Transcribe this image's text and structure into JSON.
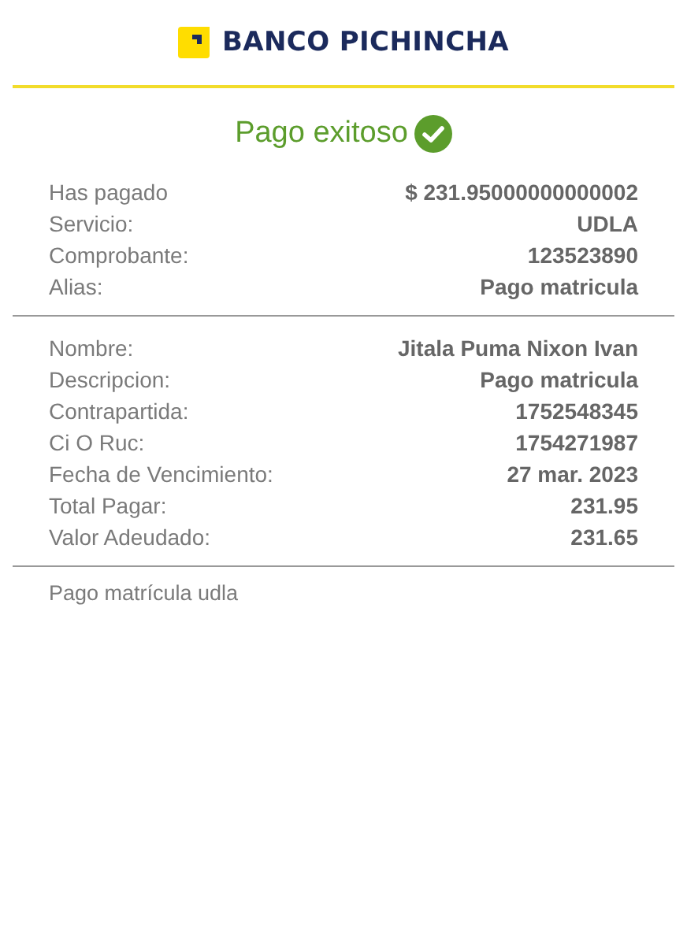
{
  "brand": {
    "name": "BANCO PICHINCHA"
  },
  "status": {
    "title": "Pago exitoso"
  },
  "summary": [
    {
      "label": "Has pagado",
      "value": "$ 231.95000000000002"
    },
    {
      "label": "Servicio:",
      "value": "UDLA"
    },
    {
      "label": "Comprobante:",
      "value": "123523890"
    },
    {
      "label": "Alias:",
      "value": "Pago matricula"
    }
  ],
  "details": [
    {
      "label": "Nombre:",
      "value": "Jitala Puma Nixon Ivan"
    },
    {
      "label": "Descripcion:",
      "value": "Pago matricula"
    },
    {
      "label": "Contrapartida:",
      "value": "1752548345"
    },
    {
      "label": "Ci O Ruc:",
      "value": "1754271987"
    },
    {
      "label": "Fecha de Vencimiento:",
      "value": "27 mar. 2023"
    },
    {
      "label": "Total Pagar:",
      "value": "231.95"
    },
    {
      "label": "Valor Adeudado:",
      "value": "231.65"
    }
  ],
  "note": "Pago matrícula udla"
}
